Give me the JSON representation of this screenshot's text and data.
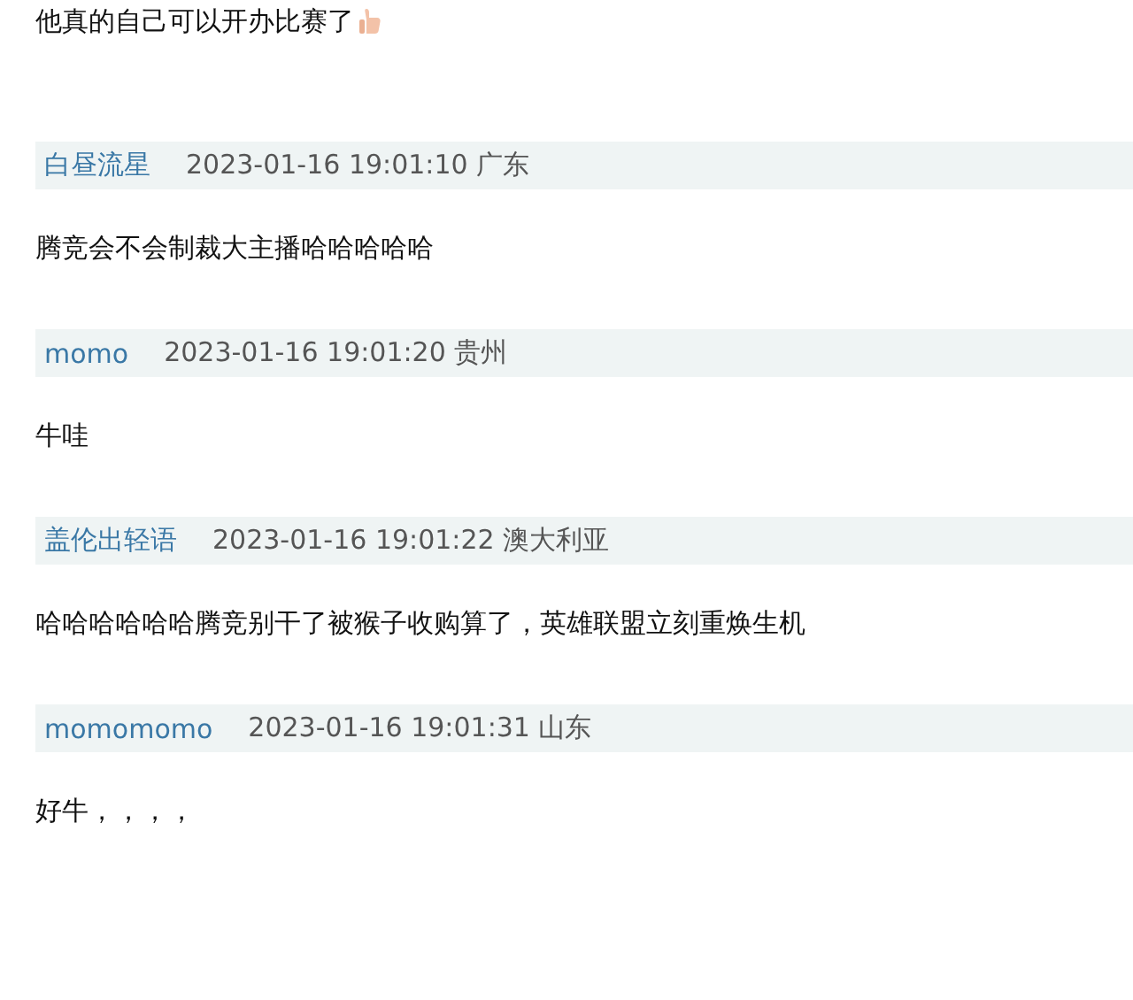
{
  "lead_comment": {
    "text": "他真的自己可以开办比赛了"
  },
  "comments": [
    {
      "username": "白昼流星",
      "meta": "2023-01-16 19:01:10 广东",
      "text": "腾竞会不会制裁大主播哈哈哈哈哈"
    },
    {
      "username": "momo",
      "meta": "2023-01-16 19:01:20 贵州",
      "text": "牛哇"
    },
    {
      "username": "盖伦出轻语",
      "meta": "2023-01-16 19:01:22 澳大利亚",
      "text": "哈哈哈哈哈哈腾竞别干了被猴子收购算了，英雄联盟立刻重焕生机"
    },
    {
      "username": "momomomo",
      "meta": "2023-01-16 19:01:31 山东",
      "text": "好牛，，，，"
    }
  ]
}
